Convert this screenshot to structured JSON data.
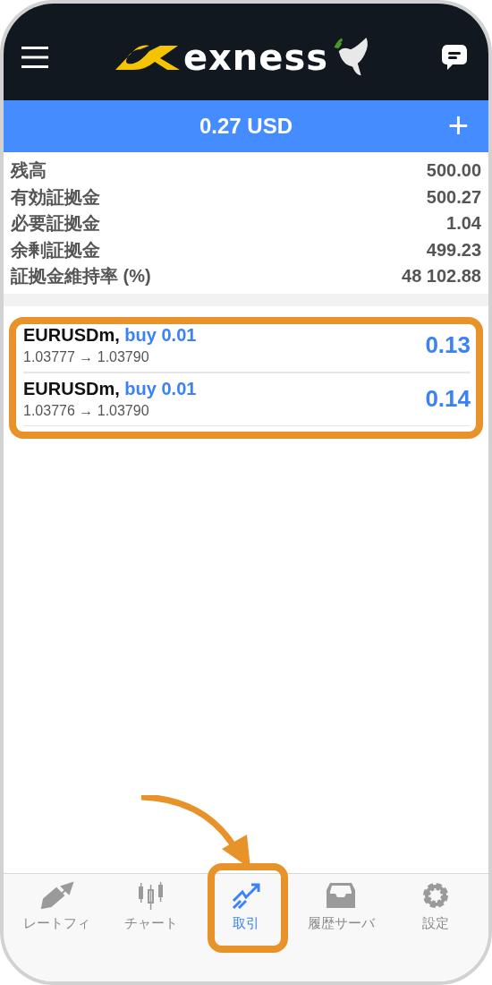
{
  "header": {
    "logo_text": "exness"
  },
  "balance_bar": {
    "amount": "0.27 USD",
    "add_button": "+"
  },
  "summary": [
    {
      "label": "残高",
      "value": "500.00"
    },
    {
      "label": "有効証拠金",
      "value": "500.27"
    },
    {
      "label": "必要証拠金",
      "value": "1.04"
    },
    {
      "label": "余剰証拠金",
      "value": "499.23"
    },
    {
      "label": "証拠金維持率 (%)",
      "value": "48 102.88"
    }
  ],
  "positions": [
    {
      "symbol": "EURUSDm,",
      "order": "buy 0.01",
      "prices": "1.03777 → 1.03790",
      "profit": "0.13"
    },
    {
      "symbol": "EURUSDm,",
      "order": "buy 0.01",
      "prices": "1.03776 → 1.03790",
      "profit": "0.14"
    }
  ],
  "tabs": [
    {
      "label": "レートフィ",
      "selected": false
    },
    {
      "label": "チャート",
      "selected": false
    },
    {
      "label": "取引",
      "selected": true
    },
    {
      "label": "履歴サーバ",
      "selected": false
    },
    {
      "label": "設定",
      "selected": false
    }
  ]
}
